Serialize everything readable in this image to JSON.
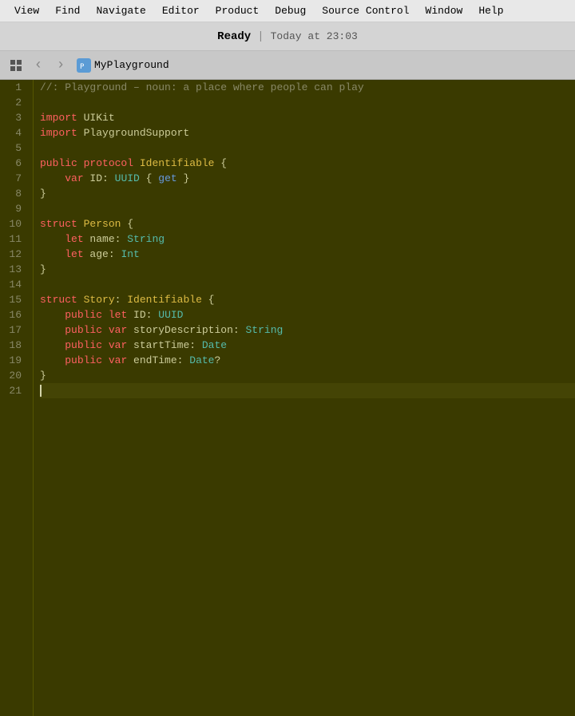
{
  "menubar": {
    "items": [
      "View",
      "Find",
      "Navigate",
      "Editor",
      "Product",
      "Debug",
      "Source Control",
      "Window",
      "Help"
    ]
  },
  "titlebar": {
    "status": "Ready",
    "separator": "|",
    "time": "Today at 23:03"
  },
  "toolbar": {
    "playground_name": "MyPlayground",
    "back_icon": "‹",
    "forward_icon": "›",
    "grid_icon": "⊞"
  },
  "editor": {
    "lines": [
      {
        "num": 1,
        "tokens": [
          {
            "t": "//: Playground – noun: a place where people can play",
            "c": "comment"
          }
        ]
      },
      {
        "num": 2,
        "tokens": []
      },
      {
        "num": 3,
        "tokens": [
          {
            "t": "import",
            "c": "keyword"
          },
          {
            "t": " UIKit",
            "c": "identifier"
          }
        ]
      },
      {
        "num": 4,
        "tokens": [
          {
            "t": "import",
            "c": "keyword"
          },
          {
            "t": " PlaygroundSupport",
            "c": "identifier"
          }
        ]
      },
      {
        "num": 5,
        "tokens": []
      },
      {
        "num": 6,
        "tokens": [
          {
            "t": "public",
            "c": "keyword"
          },
          {
            "t": " ",
            "c": "identifier"
          },
          {
            "t": "protocol",
            "c": "keyword"
          },
          {
            "t": " ",
            "c": "identifier"
          },
          {
            "t": "Identifiable",
            "c": "type-name"
          },
          {
            "t": " {",
            "c": "punctuation"
          }
        ]
      },
      {
        "num": 7,
        "tokens": [
          {
            "t": "    ",
            "c": "identifier"
          },
          {
            "t": "var",
            "c": "keyword"
          },
          {
            "t": " ID: ",
            "c": "identifier"
          },
          {
            "t": "UUID",
            "c": "type-ref"
          },
          {
            "t": " { ",
            "c": "punctuation"
          },
          {
            "t": "get",
            "c": "keyword-blue"
          },
          {
            "t": " }",
            "c": "punctuation"
          }
        ]
      },
      {
        "num": 8,
        "tokens": [
          {
            "t": "}",
            "c": "punctuation"
          }
        ]
      },
      {
        "num": 9,
        "tokens": []
      },
      {
        "num": 10,
        "tokens": [
          {
            "t": "struct",
            "c": "keyword"
          },
          {
            "t": " ",
            "c": "identifier"
          },
          {
            "t": "Person",
            "c": "type-name"
          },
          {
            "t": " {",
            "c": "punctuation"
          }
        ]
      },
      {
        "num": 11,
        "tokens": [
          {
            "t": "    ",
            "c": "identifier"
          },
          {
            "t": "let",
            "c": "keyword"
          },
          {
            "t": " name: ",
            "c": "identifier"
          },
          {
            "t": "String",
            "c": "type-ref"
          }
        ]
      },
      {
        "num": 12,
        "tokens": [
          {
            "t": "    ",
            "c": "identifier"
          },
          {
            "t": "let",
            "c": "keyword"
          },
          {
            "t": " age: ",
            "c": "identifier"
          },
          {
            "t": "Int",
            "c": "type-ref"
          }
        ]
      },
      {
        "num": 13,
        "tokens": [
          {
            "t": "}",
            "c": "punctuation"
          }
        ]
      },
      {
        "num": 14,
        "tokens": []
      },
      {
        "num": 15,
        "tokens": [
          {
            "t": "struct",
            "c": "keyword"
          },
          {
            "t": " ",
            "c": "identifier"
          },
          {
            "t": "Story",
            "c": "type-name"
          },
          {
            "t": ": ",
            "c": "punctuation"
          },
          {
            "t": "Identifiable",
            "c": "type-name"
          },
          {
            "t": " {",
            "c": "punctuation"
          }
        ]
      },
      {
        "num": 16,
        "tokens": [
          {
            "t": "    ",
            "c": "identifier"
          },
          {
            "t": "public",
            "c": "keyword"
          },
          {
            "t": " ",
            "c": "identifier"
          },
          {
            "t": "let",
            "c": "keyword"
          },
          {
            "t": " ID: ",
            "c": "identifier"
          },
          {
            "t": "UUID",
            "c": "type-ref"
          }
        ]
      },
      {
        "num": 17,
        "tokens": [
          {
            "t": "    ",
            "c": "identifier"
          },
          {
            "t": "public",
            "c": "keyword"
          },
          {
            "t": " ",
            "c": "identifier"
          },
          {
            "t": "var",
            "c": "keyword"
          },
          {
            "t": " storyDescription: ",
            "c": "identifier"
          },
          {
            "t": "String",
            "c": "type-ref"
          }
        ]
      },
      {
        "num": 18,
        "tokens": [
          {
            "t": "    ",
            "c": "identifier"
          },
          {
            "t": "public",
            "c": "keyword"
          },
          {
            "t": " ",
            "c": "identifier"
          },
          {
            "t": "var",
            "c": "keyword"
          },
          {
            "t": " startTime: ",
            "c": "identifier"
          },
          {
            "t": "Date",
            "c": "type-ref"
          }
        ]
      },
      {
        "num": 19,
        "tokens": [
          {
            "t": "    ",
            "c": "identifier"
          },
          {
            "t": "public",
            "c": "keyword"
          },
          {
            "t": " ",
            "c": "identifier"
          },
          {
            "t": "var",
            "c": "keyword"
          },
          {
            "t": " endTime: ",
            "c": "identifier"
          },
          {
            "t": "Date",
            "c": "type-ref"
          },
          {
            "t": "?",
            "c": "punctuation"
          }
        ]
      },
      {
        "num": 20,
        "tokens": [
          {
            "t": "}",
            "c": "punctuation"
          }
        ]
      },
      {
        "num": 21,
        "tokens": [],
        "cursor": true
      }
    ]
  }
}
